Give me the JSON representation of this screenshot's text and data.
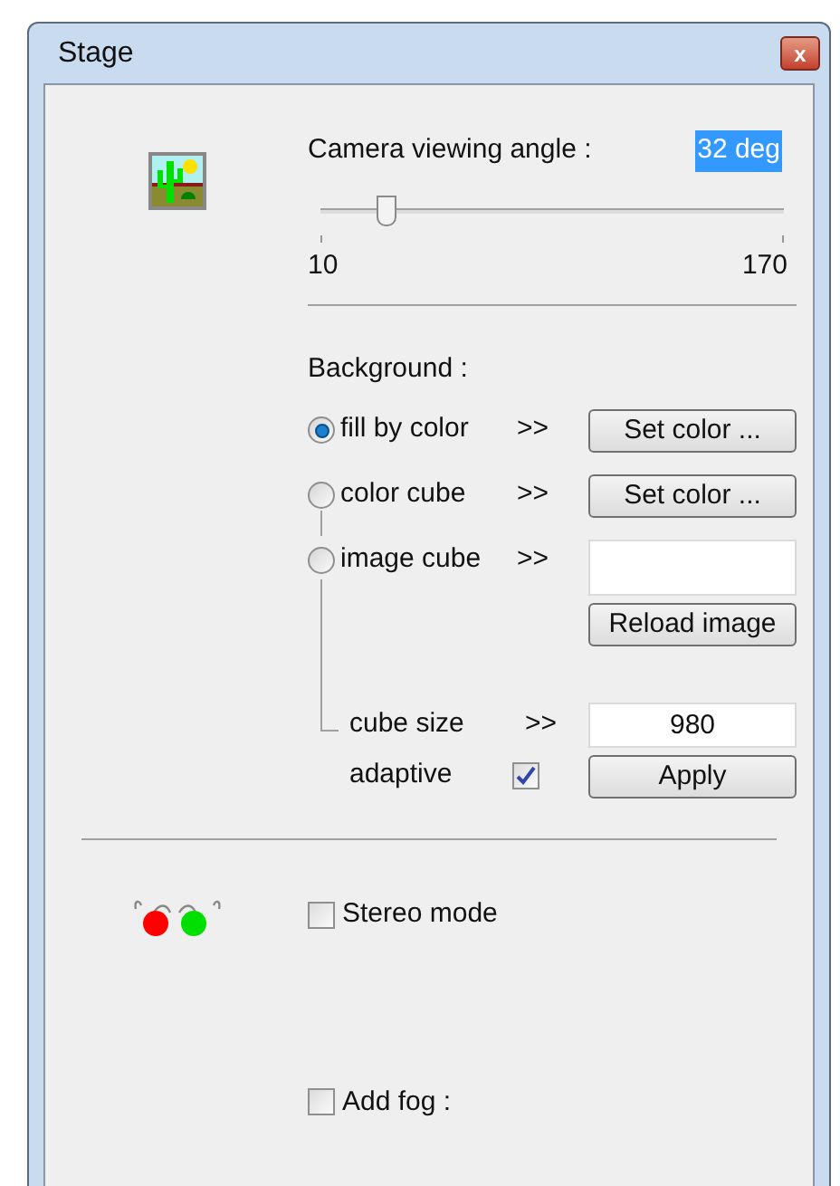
{
  "window": {
    "title": "Stage",
    "close": "x"
  },
  "camera": {
    "label": "Camera viewing angle :",
    "value": "32 deg",
    "level": 0.14,
    "min": "10",
    "max": "170"
  },
  "background": {
    "label": "Background :",
    "options": [
      {
        "label": "fill by color",
        "arrow": ">>",
        "selected": true,
        "kind": "button",
        "button": "Set color ..."
      },
      {
        "label": "color cube",
        "arrow": ">>",
        "selected": false,
        "kind": "button",
        "button": "Set color ..."
      },
      {
        "label": "image cube",
        "arrow": ">>",
        "selected": false,
        "kind": "image",
        "button": "Reload image"
      }
    ],
    "cube_size": {
      "label": "cube size",
      "arrow": ">>",
      "value": "980"
    },
    "adaptive": {
      "label": "adaptive",
      "checked": true,
      "button": "Apply"
    }
  },
  "stereo": {
    "label": "Stereo mode",
    "checked": false
  },
  "fog": {
    "label": "Add fog :",
    "checked": false
  }
}
